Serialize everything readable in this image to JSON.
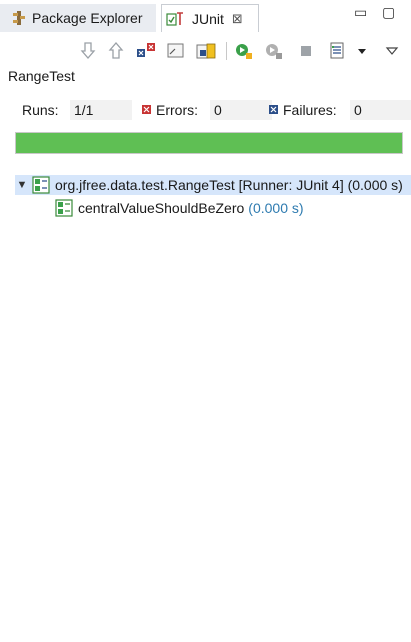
{
  "tabs": [
    {
      "label": "Package Explorer",
      "icon": "package-explorer-icon"
    },
    {
      "label": "JUnit",
      "icon": "junit-icon",
      "close": "⊠"
    }
  ],
  "window_controls": {
    "minimize": "▭",
    "maximize": "▢"
  },
  "toolbar": {
    "icons": [
      "next-failure-icon",
      "previous-failure-icon",
      "show-failures-only-icon",
      "scroll-lock-icon",
      "show-skipped-icon",
      "rerun-test-icon",
      "rerun-failed-first-icon",
      "stop-icon",
      "test-run-history-icon",
      "dropdown-icon",
      "view-menu-icon"
    ]
  },
  "run_title": "RangeTest",
  "counters": {
    "runs_label": "Runs:",
    "runs_value": "1/1",
    "errors_label": "Errors:",
    "errors_value": "0",
    "failures_label": "Failures:",
    "failures_value": "0"
  },
  "progress": {
    "fraction": 1.0,
    "color": "#5fbf54"
  },
  "tree": {
    "suite": {
      "label": "org.jfree.data.test.RangeTest [Runner: JUnit 4] (0.000 s)"
    },
    "tests": [
      {
        "name": "centralValueShouldBeZero",
        "time": "(0.000 s)"
      }
    ]
  }
}
